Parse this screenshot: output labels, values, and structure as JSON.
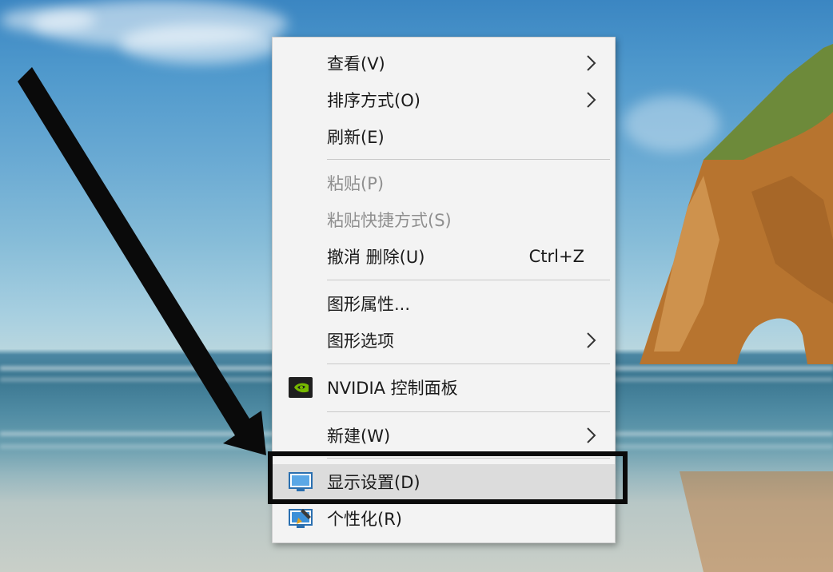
{
  "menu": {
    "items": [
      {
        "label": "查看(V)",
        "submenu": true
      },
      {
        "label": "排序方式(O)",
        "submenu": true
      },
      {
        "label": "刷新(E)"
      },
      {
        "label": "粘贴(P)",
        "disabled": true
      },
      {
        "label": "粘贴快捷方式(S)",
        "disabled": true
      },
      {
        "label": "撤消 删除(U)",
        "shortcut": "Ctrl+Z"
      },
      {
        "label": "图形属性..."
      },
      {
        "label": "图形选项",
        "submenu": true
      },
      {
        "label": "NVIDIA 控制面板",
        "icon": "nvidia-icon"
      },
      {
        "label": "新建(W)",
        "submenu": true
      },
      {
        "label": "显示设置(D)",
        "icon": "display-icon",
        "highlighted": true
      },
      {
        "label": "个性化(R)",
        "icon": "personalize-icon"
      }
    ]
  },
  "colors": {
    "menu_bg": "#f3f3f3",
    "highlight": "#dcdcdc",
    "disabled_text": "#8f8f8f",
    "nvidia_green": "#76b900",
    "annotation": "#0a0a0a"
  }
}
